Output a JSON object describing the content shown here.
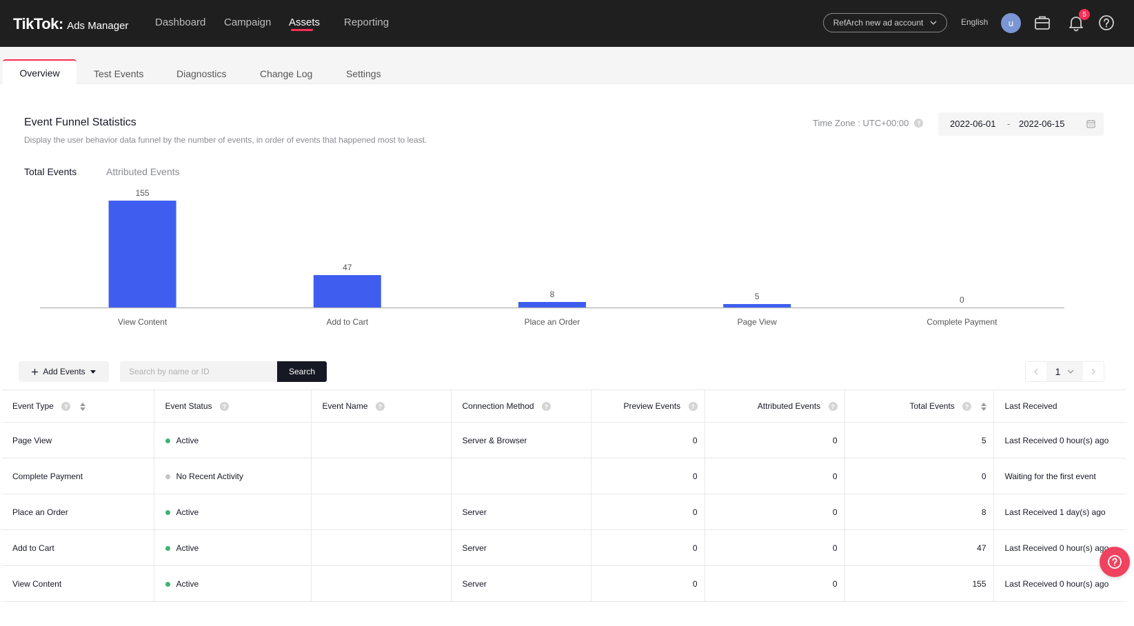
{
  "header": {
    "brand": "TikTok",
    "brand_sub": "Ads Manager",
    "nav": [
      "Dashboard",
      "Campaign",
      "Assets",
      "Reporting"
    ],
    "active_nav": "Assets",
    "account": "RefArch new ad account",
    "language": "English",
    "avatar_letter": "u",
    "notification_count": "5"
  },
  "tabs": [
    "Overview",
    "Test Events",
    "Diagnostics",
    "Change Log",
    "Settings"
  ],
  "funnel": {
    "title": "Event Funnel Statistics",
    "description": "Display the user behavior data funnel by the number of events, in order of events that happened most to least.",
    "timezone": "Time Zone : UTC+00:00",
    "date_start": "2022-06-01",
    "date_sep": "-",
    "date_end": "2022-06-15",
    "subtabs": [
      "Total Events",
      "Attributed Events"
    ]
  },
  "chart_data": {
    "type": "bar",
    "categories": [
      "View Content",
      "Add to Cart",
      "Place an Order",
      "Page View",
      "Complete Payment"
    ],
    "values": [
      155,
      47,
      8,
      5,
      0
    ],
    "title": "",
    "xlabel": "",
    "ylabel": "",
    "bar_color": "#3f5ef0",
    "grid": false
  },
  "toolbar": {
    "add_events": "Add Events",
    "search_placeholder": "Search by name or ID",
    "search_button": "Search",
    "page": "1"
  },
  "table": {
    "columns": [
      "Event Type",
      "Event Status",
      "Event Name",
      "Connection Method",
      "Preview Events",
      "Attributed Events",
      "Total Events",
      "Last Received"
    ],
    "rows": [
      {
        "type": "Page View",
        "status": "Active",
        "status_color": "#3cb371",
        "name": "",
        "method": "Server & Browser",
        "preview": "0",
        "attributed": "0",
        "total": "5",
        "last": "Last Received 0 hour(s) ago"
      },
      {
        "type": "Complete Payment",
        "status": "No Recent Activity",
        "status_color": "#c4c4c4",
        "name": "",
        "method": "",
        "preview": "0",
        "attributed": "0",
        "total": "0",
        "last": "Waiting for the first event"
      },
      {
        "type": "Place an Order",
        "status": "Active",
        "status_color": "#3cb371",
        "name": "",
        "method": "Server",
        "preview": "0",
        "attributed": "0",
        "total": "8",
        "last": "Last Received 1 day(s) ago"
      },
      {
        "type": "Add to Cart",
        "status": "Active",
        "status_color": "#3cb371",
        "name": "",
        "method": "Server",
        "preview": "0",
        "attributed": "0",
        "total": "47",
        "last": "Last Received 0 hour(s) ago"
      },
      {
        "type": "View Content",
        "status": "Active",
        "status_color": "#3cb371",
        "name": "",
        "method": "Server",
        "preview": "0",
        "attributed": "0",
        "total": "155",
        "last": "Last Received 0 hour(s) ago"
      }
    ]
  }
}
